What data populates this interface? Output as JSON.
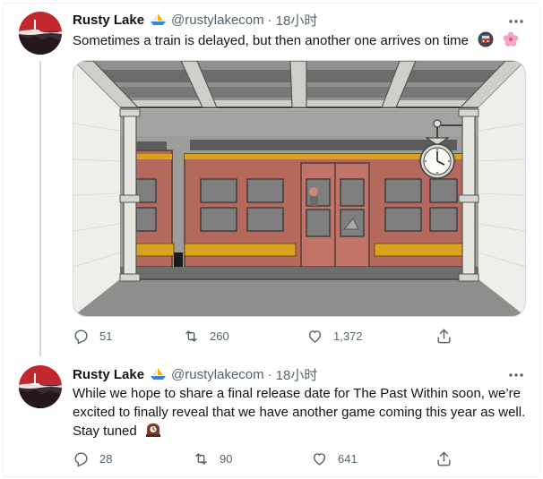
{
  "tweets": [
    {
      "name": "Rusty Lake",
      "handle": "@rustylakecom",
      "separator": "·",
      "time": "18小时",
      "text": "Sometimes a train is delayed, but then another one arrives on time",
      "emoji_after_text": [
        "train-face-icon",
        "cherry-blossom-icon"
      ],
      "replies": "51",
      "retweets": "260",
      "likes": "1,372"
    },
    {
      "name": "Rusty Lake",
      "handle": "@rustylakecom",
      "separator": "·",
      "time": "18小时",
      "text_lines": [
        "While we hope to share a final release date for The Past Within soon, we’re",
        "excited to finally reveal that we have another game coming this year as well.",
        "Stay tuned"
      ],
      "emoji_after_text": [
        "mantelpiece-clock-icon"
      ],
      "replies": "28",
      "retweets": "90",
      "likes": "641"
    }
  ],
  "colors": {
    "text": "#0f1419",
    "secondary": "#536471",
    "thread_line": "#cfd9de",
    "train_red": "#b5685c",
    "train_yellow": "#d9a21f"
  }
}
